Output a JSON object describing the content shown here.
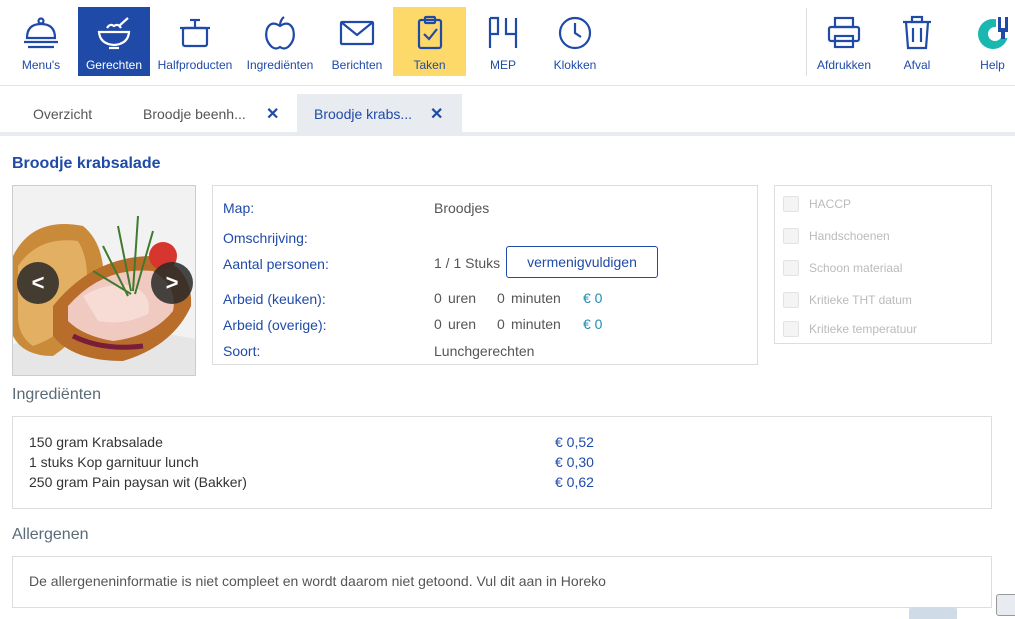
{
  "toolbar": {
    "items": [
      {
        "label": "Menu's",
        "icon": "cloche-icon"
      },
      {
        "label": "Gerechten",
        "icon": "bowl-icon"
      },
      {
        "label": "Halfproducten",
        "icon": "pot-icon"
      },
      {
        "label": "Ingrediënten",
        "icon": "apple-icon"
      },
      {
        "label": "Berichten",
        "icon": "envelope-icon"
      },
      {
        "label": "Taken",
        "icon": "clipboard-check-icon"
      },
      {
        "label": "MEP",
        "icon": "mep-icon"
      },
      {
        "label": "Klokken",
        "icon": "clock-icon"
      },
      {
        "label": "Afdrukken",
        "icon": "printer-icon"
      },
      {
        "label": "Afval",
        "icon": "trash-icon"
      },
      {
        "label": "Help",
        "icon": "help-logo-icon"
      }
    ],
    "accent_blue": "#1f4aa8",
    "accent_yellow": "#fdd96a"
  },
  "tabs": [
    {
      "label": "Overzicht"
    },
    {
      "label": "Broodje beenh...",
      "close": "✕"
    },
    {
      "label": "Broodje krabs...",
      "close": "✕"
    }
  ],
  "dish": {
    "title": "Broodje krabsalade",
    "photo": {
      "prev": "<",
      "next": ">"
    },
    "fields": {
      "map_label": "Map:",
      "map_value": "Broodjes",
      "omschrijving_label": "Omschrijving:",
      "personen_label": "Aantal personen:",
      "personen_value": "1 / 1 Stuks",
      "multiply_button": "vermenigvuldigen",
      "arbeid_keuken_label": "Arbeid (keuken):",
      "arbeid_keuken_uren": "0",
      "arbeid_keuken_minuten": "0",
      "arbeid_keuken_euro": "€ 0",
      "arbeid_overige_label": "Arbeid (overige):",
      "arbeid_overige_uren": "0",
      "arbeid_overige_minuten": "0",
      "arbeid_overige_euro": "€ 0",
      "uren_unit": "uren",
      "minuten_unit": "minuten",
      "soort_label": "Soort:",
      "soort_value": "Lunchgerechten"
    },
    "checks": [
      "HACCP",
      "Handschoenen",
      "Schoon materiaal",
      "Kritieke THT datum",
      "Kritieke temperatuur"
    ]
  },
  "ingredients": {
    "title": "Ingrediënten",
    "items": [
      {
        "name": "150 gram Krabsalade",
        "price": "€ 0,52"
      },
      {
        "name": "1 stuks Kop garnituur lunch",
        "price": "€ 0,30"
      },
      {
        "name": "250 gram Pain paysan wit (Bakker)",
        "price": "€ 0,62"
      }
    ]
  },
  "allergens": {
    "title": "Allergenen",
    "message": "De allergeneninformatie is niet compleet en wordt daarom niet getoond. Vul dit aan in Horeko"
  }
}
